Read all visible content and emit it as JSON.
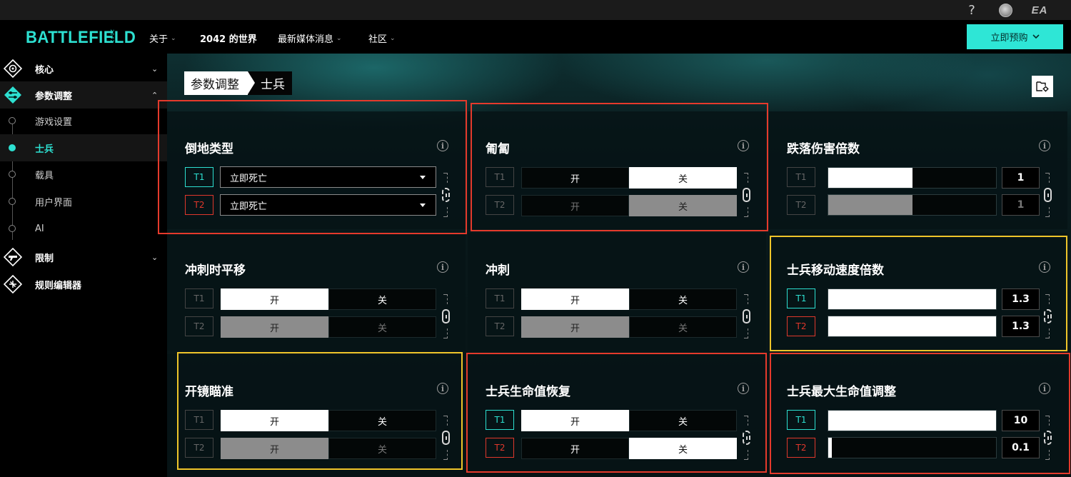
{
  "topbar": {
    "help_icon": "?",
    "ea_logo": "EA"
  },
  "nav": {
    "logo": "BATTLEFIELD",
    "logo_sub": "2042",
    "items": [
      {
        "label": "关于",
        "caret": true
      },
      {
        "label": "2042 的世界",
        "caret": false
      },
      {
        "label": "最新媒体消息",
        "caret": true
      },
      {
        "label": "社区",
        "caret": true
      }
    ],
    "preorder": "立即预购"
  },
  "sidebar": {
    "core": "核心",
    "tuning": "参数调整",
    "game_settings": "游戏设置",
    "soldier": "士兵",
    "vehicles": "载具",
    "ui": "用户界面",
    "ai": "AI",
    "restrictions": "限制",
    "rules_editor": "规则编辑器"
  },
  "breadcrumb": {
    "parent": "参数调整",
    "current": "士兵"
  },
  "labels": {
    "t1": "T1",
    "t2": "T2",
    "on": "开",
    "off": "关",
    "info": "i"
  },
  "panels": {
    "down_type": {
      "title": "倒地类型",
      "t1_value": "立即死亡",
      "t2_value": "立即死亡"
    },
    "prone": {
      "title": "匍匐",
      "t1_selected": "off",
      "t2_selected": "off"
    },
    "fall_damage": {
      "title": "跌落伤害倍数",
      "t1_value": "1",
      "t2_value": "1",
      "t1_fill": 0.5,
      "t2_fill": 0.5
    },
    "sprint_slide": {
      "title": "冲刺时平移",
      "t1_selected": "on",
      "t2_selected": "on"
    },
    "sprint": {
      "title": "冲刺",
      "t1_selected": "on",
      "t2_selected": "on"
    },
    "move_speed": {
      "title": "士兵移动速度倍数",
      "t1_value": "1.3",
      "t2_value": "1.3",
      "t1_fill": 1.0,
      "t2_fill": 1.0
    },
    "ads": {
      "title": "开镜瞄准",
      "t1_selected": "on",
      "t2_selected": "on"
    },
    "health_regen": {
      "title": "士兵生命值恢复",
      "t1_selected": "on",
      "t2_selected": "off"
    },
    "max_health": {
      "title": "士兵最大生命值调整",
      "t1_value": "10",
      "t2_value": "0.1",
      "t1_fill": 1.0,
      "t2_fill": 0.02
    }
  },
  "colors": {
    "accent": "#2de0d1",
    "team2": "#e0382c",
    "highlight_red": "#e53a2c",
    "highlight_yellow": "#efc52a"
  }
}
